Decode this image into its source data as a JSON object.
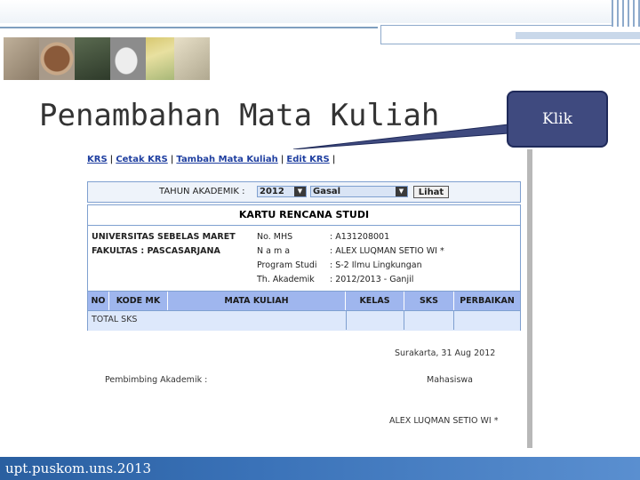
{
  "slide": {
    "title": "Penambahan Mata Kuliah",
    "callout": "Klik",
    "footer": "upt.puskom.uns.2013"
  },
  "nav": {
    "items": [
      "KRS",
      "Cetak KRS",
      "Tambah Mata Kuliah",
      "Edit KRS"
    ],
    "separator": "|"
  },
  "filter": {
    "label": "TAHUN AKADEMIK :",
    "year": "2012",
    "semester": "Gasal",
    "button": "Lihat"
  },
  "krs": {
    "title": "KARTU RENCANA STUDI",
    "university": "UNIVERSITAS SEBELAS MARET",
    "faculty": "FAKULTAS : PASCASARJANA",
    "fields": [
      {
        "label": "No. MHS",
        "value": ": A131208001"
      },
      {
        "label": "N a m a",
        "value": ": ALEX LUQMAN SETIO WI *"
      },
      {
        "label": "Program Studi",
        "value": ": S-2 Ilmu Lingkungan"
      },
      {
        "label": "Th. Akademik",
        "value": ": 2012/2013 - Ganjil"
      }
    ],
    "columns": [
      "NO",
      "KODE MK",
      "MATA KULIAH",
      "KELAS",
      "SKS",
      "PERBAIKAN"
    ],
    "total_label": "TOTAL SKS"
  },
  "signature": {
    "place_date": "Surakarta, 31 Aug 2012",
    "advisor_label": "Pembimbing Akademik :",
    "student_label": "Mahasiswa",
    "student_name": "ALEX LUQMAN SETIO WI *"
  },
  "colors": {
    "accent": "#3f4a7f",
    "table_header": "#9fb6ee",
    "footer": "#2a5fa0",
    "link": "#1f3fa0"
  }
}
